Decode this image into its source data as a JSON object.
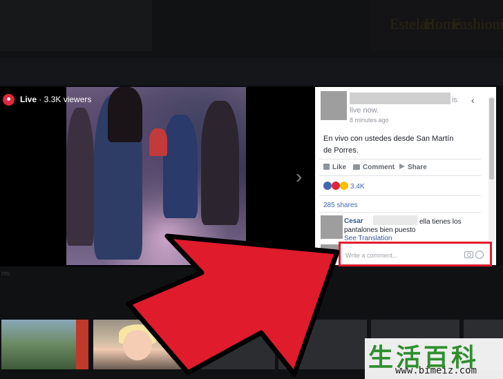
{
  "player": {
    "live_label": "Live",
    "viewers": " · 3.3K viewers",
    "next_glyph": "›"
  },
  "post": {
    "is_suffix": "is",
    "status": "live now.",
    "time_ago": "8 minutes ago",
    "text": "En vivo con ustedes desde San Martín de Porres.",
    "back_glyph": "‹"
  },
  "actions": {
    "like": "Like",
    "comment": "Comment",
    "share": "Share"
  },
  "reactions": {
    "count": "3.4K",
    "colors": [
      "#4267b2",
      "#e0263e",
      "#f7c000"
    ]
  },
  "shares": "285 shares",
  "comment": {
    "author": "Cesar",
    "text_line1": "ella tienes los",
    "text_line2": "pantalones bien puesto",
    "see_translation": "See Translation"
  },
  "composer": {
    "placeholder": "Write a comment..."
  },
  "background": {
    "tab_hint": "nts"
  },
  "brand_words": [
    "Estelar",
    "Home",
    "Fashionista"
  ],
  "watermark": {
    "logo": "生活百科",
    "url": "www.bimeiz.com"
  },
  "colors": {
    "highlight": "#e01b2b",
    "live_badge": "#e0263e",
    "link": "#4267b2"
  }
}
